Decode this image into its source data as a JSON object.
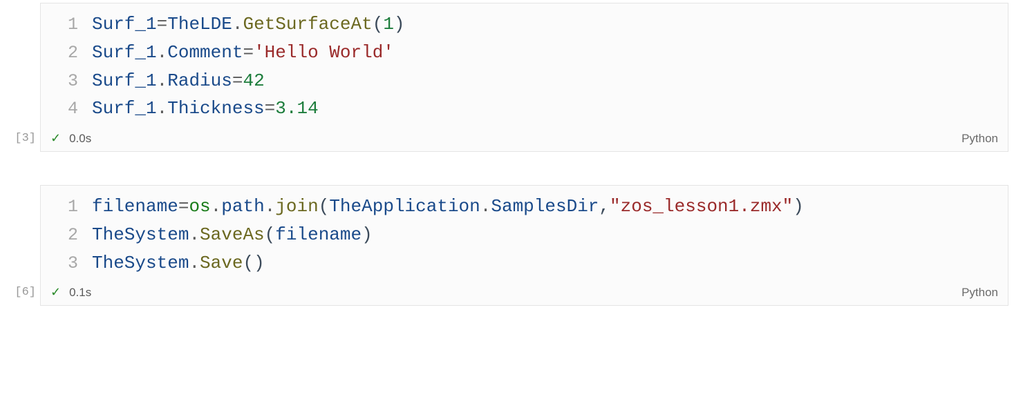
{
  "cells": [
    {
      "exec_label": "[3]",
      "exec_time": "0.0s",
      "language": "Python",
      "check": "✓",
      "lines": {
        "l1": {
          "num": "1",
          "t1": "Surf_1",
          "t2": " = ",
          "t3": "TheLDE",
          "t4": ".",
          "t5": "GetSurfaceAt",
          "t6": "(",
          "t7": "1",
          "t8": ")"
        },
        "l2": {
          "num": "2",
          "t1": "Surf_1",
          "t2": ".",
          "t3": "Comment",
          "t4": " = ",
          "t5": "'Hello World'"
        },
        "l3": {
          "num": "3",
          "t1": "Surf_1",
          "t2": ".",
          "t3": "Radius",
          "t4": "  = ",
          "t5": "42"
        },
        "l4": {
          "num": "4",
          "t1": "Surf_1",
          "t2": ".",
          "t3": "Thickness",
          "t4": "=",
          "t5": "3.14"
        }
      }
    },
    {
      "exec_label": "[6]",
      "exec_time": "0.1s",
      "language": "Python",
      "check": "✓",
      "lines": {
        "l1": {
          "num": "1",
          "t1": "filename",
          "t2": "=",
          "t3": "os",
          "t4": ".",
          "t5": "path",
          "t6": ".",
          "t7": "join",
          "t8": "(",
          "t9": "TheApplication",
          "t10": ".",
          "t11": "SamplesDir",
          "t12": ",",
          "t13": "\"zos_lesson1.zmx\"",
          "t14": ")"
        },
        "l2": {
          "num": "2",
          "t1": "TheSystem",
          "t2": ".",
          "t3": "SaveAs",
          "t4": "(",
          "t5": "filename",
          "t6": ")"
        },
        "l3": {
          "num": "3",
          "t1": "TheSystem",
          "t2": ".",
          "t3": "Save",
          "t4": "(",
          "t5": ")"
        }
      }
    }
  ]
}
